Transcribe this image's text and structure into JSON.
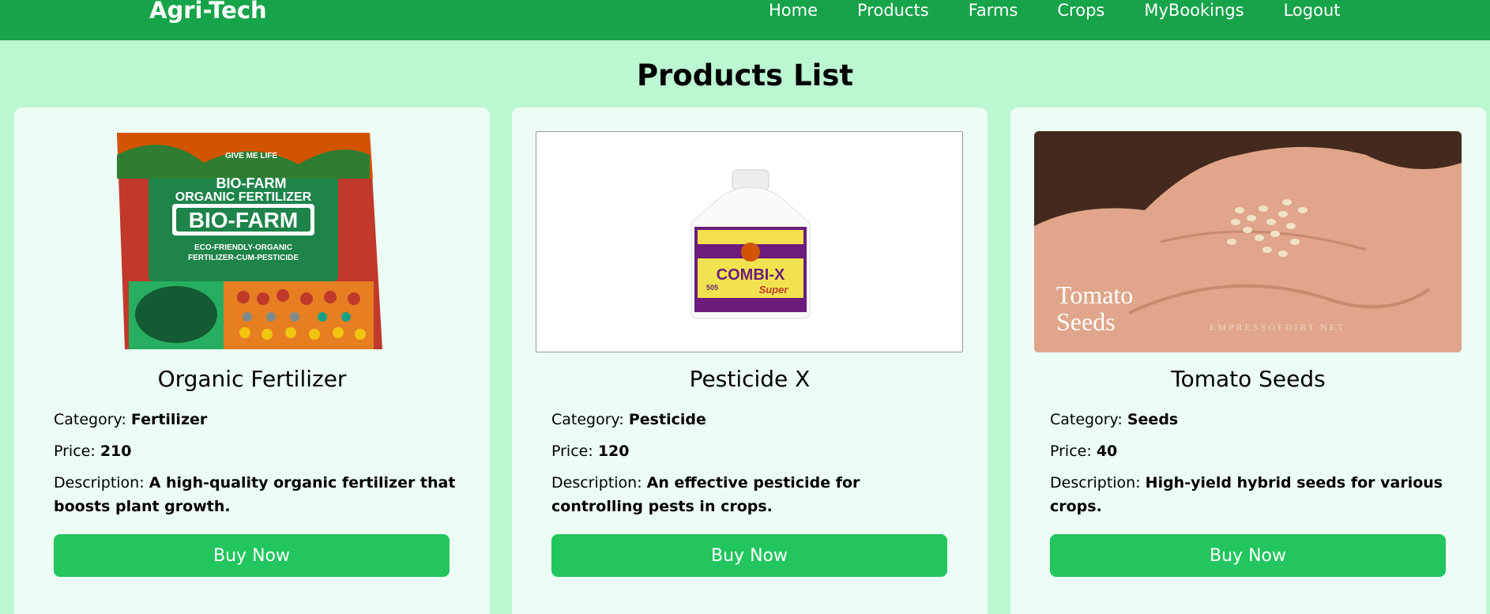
{
  "nav": {
    "brand": "Agri-Tech",
    "links": [
      "Home",
      "Products",
      "Farms",
      "Crops",
      "MyBookings",
      "Logout"
    ]
  },
  "page_title": "Products List",
  "labels": {
    "category": "Category:",
    "price": "Price:",
    "description": "Description:",
    "buy": "Buy Now"
  },
  "products": [
    {
      "name": "Organic Fertilizer",
      "category": "Fertilizer",
      "price": "210",
      "description": "A high-quality organic fertilizer that boosts plant growth.",
      "image_text": [
        "GIVE ME LIFE",
        "BIO-FARM",
        "ORGANIC FERTILIZER",
        "BIO-FARM",
        "ECO-FRIENDLY-ORGANIC",
        "FERTILIZER-CUM-PESTICIDE"
      ]
    },
    {
      "name": "Pesticide X",
      "category": "Pesticide",
      "price": "120",
      "description": "An effective pesticide for controlling pests in crops.",
      "image_text": [
        "COMBI-X",
        "Super",
        "505"
      ]
    },
    {
      "name": "Tomato Seeds",
      "category": "Seeds",
      "price": "40",
      "description": "High-yield hybrid seeds for various crops.",
      "image_text": [
        "Tomato",
        "Seeds",
        "EMPRESSOFDIRT.NET"
      ]
    }
  ],
  "colors": {
    "nav_bg": "#16a34a",
    "page_bg": "#bbf7d0",
    "card_bg": "#ecfdf5",
    "button_bg": "#22c55e"
  }
}
